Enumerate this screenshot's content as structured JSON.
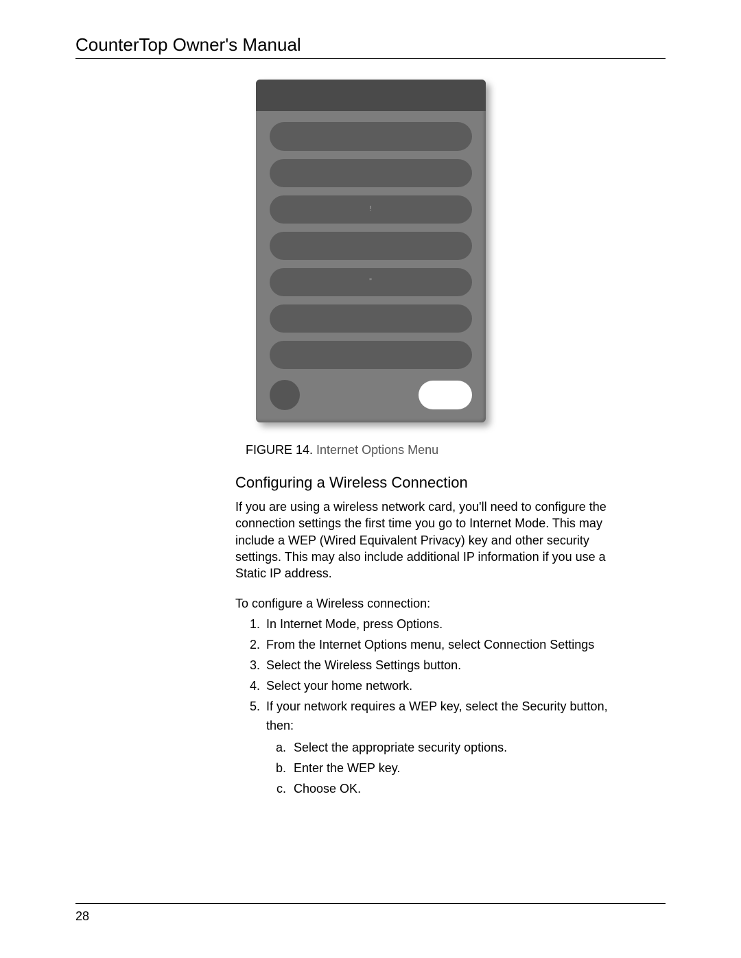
{
  "header": {
    "title": "CounterTop Owner's Manual"
  },
  "figure": {
    "label": "FIGURE 14.",
    "title": "Internet Options Menu",
    "device": {
      "pill_marks": [
        "",
        "",
        "!",
        "",
        "\"",
        "",
        ""
      ]
    }
  },
  "section": {
    "heading": "Configuring a Wireless Connection",
    "paragraph": "If you are using a wireless network card, you'll need to configure the connection settings the first time you go to Internet Mode. This may include a WEP (Wired Equivalent Privacy) key and other security settings. This may also include additional IP information if you use a Static IP address.",
    "intro": "To configure a Wireless connection:",
    "steps": {
      "s1_a": "In Internet Mode, press ",
      "s1_b": "Options",
      "s1_c": ".",
      "s2_a": "From the Internet Options menu, select ",
      "s2_b": "Connection Settings",
      "s3_a": "Select the ",
      "s3_b": "Wireless Settings",
      "s3_c": " button.",
      "s4": "Select your home network.",
      "s5_a": "If your network requires a WEP key, select the ",
      "s5_b": "Security",
      "s5_c": " button, then:",
      "sub": {
        "a": "Select the appropriate security options.",
        "b": "Enter the WEP key.",
        "c_a": "Choose ",
        "c_b": "OK",
        "c_c": "."
      }
    }
  },
  "footer": {
    "page": "28"
  }
}
